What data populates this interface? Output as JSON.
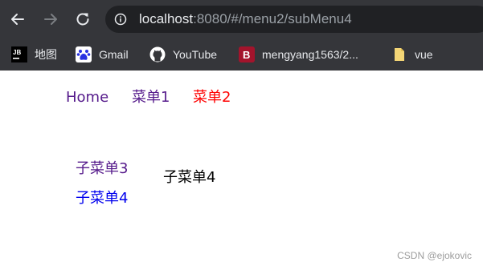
{
  "browser": {
    "url_host": "localhost",
    "url_rest": ":8080/#/menu2/subMenu4",
    "bookmarks": [
      {
        "label": "地图",
        "icon": "jetbrains-icon"
      },
      {
        "label": "Gmail",
        "icon": "baidu-paw-icon"
      },
      {
        "label": "YouTube",
        "icon": "github-icon"
      },
      {
        "label": "mengyang1563/2...",
        "icon": "b-letter-icon"
      },
      {
        "label": "vue",
        "icon": "folder-icon"
      }
    ]
  },
  "topnav": {
    "home": "Home",
    "menu1": "菜单1",
    "menu2": "菜单2"
  },
  "subnav": {
    "sub3": "子菜单3",
    "sub4": "子菜单4"
  },
  "content": {
    "text": "子菜单4"
  },
  "watermark": "CSDN @ejokovic",
  "colors": {
    "link_visited": "#551a8b",
    "link_active": "#ff0000",
    "link_default": "#0000ee",
    "chrome_bg": "#35363a"
  }
}
